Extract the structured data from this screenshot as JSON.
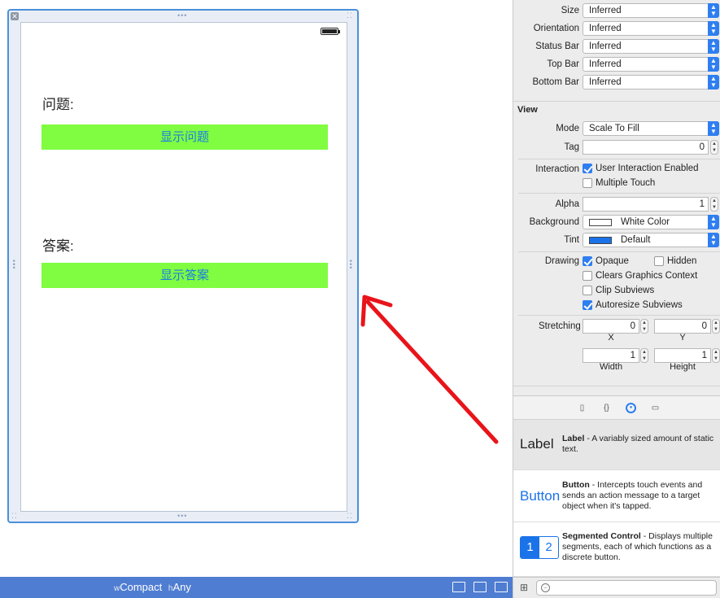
{
  "scene": {
    "question_label": "问题:",
    "show_question_button": "显示问题",
    "answer_label": "答案:",
    "show_answer_button": "显示答案"
  },
  "size_class_bar": {
    "w_prefix": "w",
    "w_value": "Compact",
    "h_prefix": "h",
    "h_value": "Any",
    "icons": [
      "align-icon",
      "pin-icon",
      "resolve-icon"
    ]
  },
  "inspector": {
    "simulated_metrics": [
      {
        "label": "Size",
        "value": "Inferred"
      },
      {
        "label": "Orientation",
        "value": "Inferred"
      },
      {
        "label": "Status Bar",
        "value": "Inferred"
      },
      {
        "label": "Top Bar",
        "value": "Inferred"
      },
      {
        "label": "Bottom Bar",
        "value": "Inferred"
      }
    ],
    "view_section_title": "View",
    "mode": {
      "label": "Mode",
      "value": "Scale To Fill"
    },
    "tag": {
      "label": "Tag",
      "value": "0"
    },
    "interaction": {
      "label": "Interaction",
      "user_interaction": {
        "label": "User Interaction Enabled",
        "checked": true
      },
      "multiple_touch": {
        "label": "Multiple Touch",
        "checked": false
      }
    },
    "alpha": {
      "label": "Alpha",
      "value": "1"
    },
    "background": {
      "label": "Background",
      "value": "White Color",
      "swatch": "#ffffff"
    },
    "tint": {
      "label": "Tint",
      "value": "Default",
      "swatch": "#1a73e8"
    },
    "drawing": {
      "label": "Drawing",
      "opaque": {
        "label": "Opaque",
        "checked": true
      },
      "hidden": {
        "label": "Hidden",
        "checked": false
      },
      "clears_graphics": {
        "label": "Clears Graphics Context",
        "checked": false
      },
      "clip_subviews": {
        "label": "Clip Subviews",
        "checked": false
      },
      "autoresize": {
        "label": "Autoresize Subviews",
        "checked": true
      }
    },
    "stretching": {
      "label": "Stretching",
      "x": {
        "value": "0",
        "label": "X"
      },
      "y": {
        "value": "0",
        "label": "Y"
      },
      "width": {
        "value": "1",
        "label": "Width"
      },
      "height": {
        "value": "1",
        "label": "Height"
      }
    }
  },
  "library": {
    "tabs": [
      "file-template-icon",
      "code-snippet-icon",
      "object-library-icon",
      "media-library-icon"
    ],
    "items": [
      {
        "icon_text": "Label",
        "title": "Label",
        "description": " - A variably sized amount of static text."
      },
      {
        "icon_text": "Button",
        "title": "Button",
        "description": " - Intercepts touch events and sends an action message to a target object when it's tapped."
      },
      {
        "icon_text_1": "1",
        "icon_text_2": "2",
        "title": "Segmented Control",
        "description": " - Displays multiple segments, each of which functions as a discrete button."
      }
    ]
  },
  "colors": {
    "button_bg": "#80fc41",
    "button_text": "#1a7fe0",
    "accent": "#2e7ef0",
    "size_bar": "#4f7dd1",
    "arrow": "#e8141a"
  }
}
